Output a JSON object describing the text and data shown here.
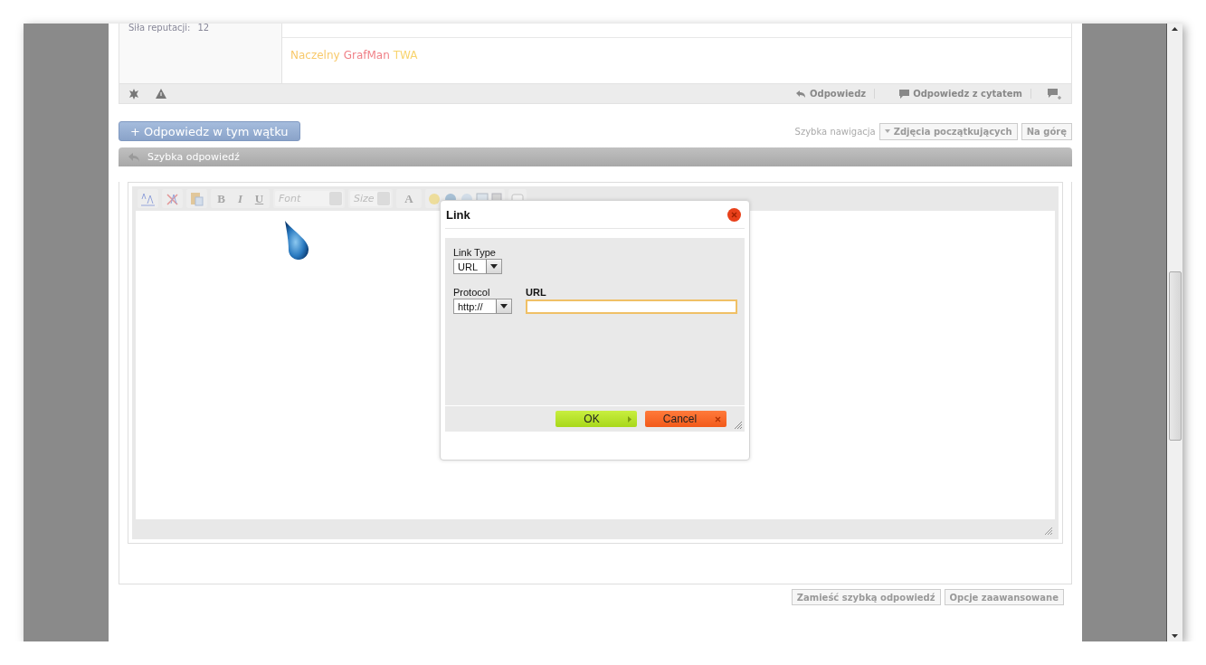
{
  "post": {
    "reputation_label": "Siła reputacji:",
    "reputation_value": "12",
    "signature": [
      {
        "text": "Naczelny",
        "color": "#f8c96b"
      },
      {
        "text": "GrafMan",
        "color": "#f07f86"
      },
      {
        "text": "TWA",
        "color": "#f8d46e"
      }
    ],
    "actions": [
      {
        "kind": "reply",
        "label": "Odpowiedz"
      },
      {
        "kind": "quote",
        "label": "Odpowiedz z cytatem"
      }
    ]
  },
  "reply_button": "+ Odpowiedz w tym wątku",
  "navigation": {
    "label": "Szybka nawigacja",
    "forum": "Zdjęcia początkujących",
    "top": "Na górę"
  },
  "quick_reply": {
    "title": "Szybka odpowiedź",
    "toolbar": {
      "disabled": true,
      "bold": "B",
      "italic": "I",
      "underline": "U",
      "font_placeholder": "Font",
      "size_placeholder": "Size",
      "text_color": "A"
    },
    "buttons": [
      "Zamieść szybką odpowiedź",
      "Opcje zaawansowane"
    ]
  },
  "dialog": {
    "title": "Link",
    "link_type": {
      "label": "Link Type",
      "value": "URL"
    },
    "protocol": {
      "label": "Protocol",
      "value": "http://"
    },
    "url": {
      "label": "URL",
      "focused": true
    },
    "buttons": [
      {
        "kind": "ok",
        "label": "OK"
      },
      {
        "kind": "cancel",
        "label": "Cancel"
      }
    ]
  }
}
